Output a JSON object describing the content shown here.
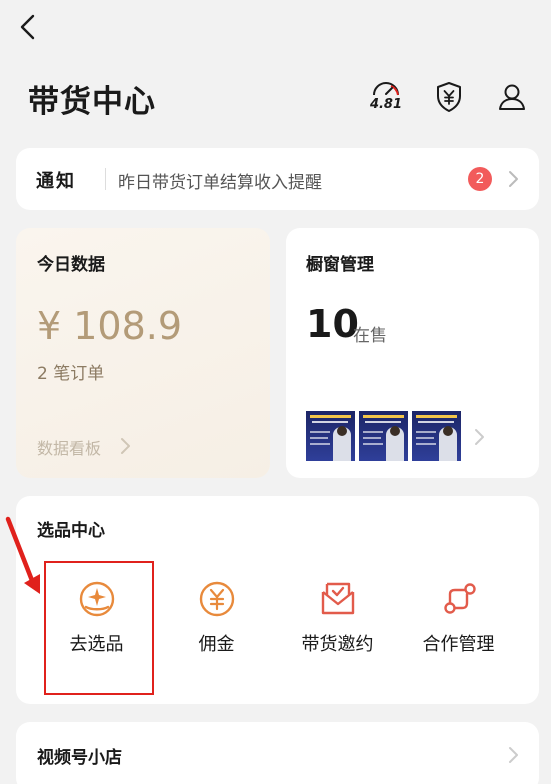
{
  "header": {
    "title": "带货中心",
    "score": "4.81"
  },
  "notice": {
    "label": "通知",
    "text": "昨日带货订单结算收入提醒",
    "badge": "2"
  },
  "today": {
    "title": "今日数据",
    "amount": "¥ 108.9",
    "orders": "2 笔订单",
    "dashboard_link": "数据看板"
  },
  "window": {
    "title": "橱窗管理",
    "count": "10",
    "unit": "在售"
  },
  "select_center": {
    "title": "选品中心",
    "items": [
      {
        "label": "去选品",
        "icon": "sparkle-hand-icon"
      },
      {
        "label": "佣金",
        "icon": "yen-circle-icon"
      },
      {
        "label": "带货邀约",
        "icon": "envelope-check-icon"
      },
      {
        "label": "合作管理",
        "icon": "connection-icon"
      }
    ]
  },
  "shop": {
    "title": "视频号小店"
  },
  "colors": {
    "accent": "#e88a3c",
    "badge": "#f25b5b",
    "amount": "#b39b78",
    "highlight": "#e0211c"
  }
}
